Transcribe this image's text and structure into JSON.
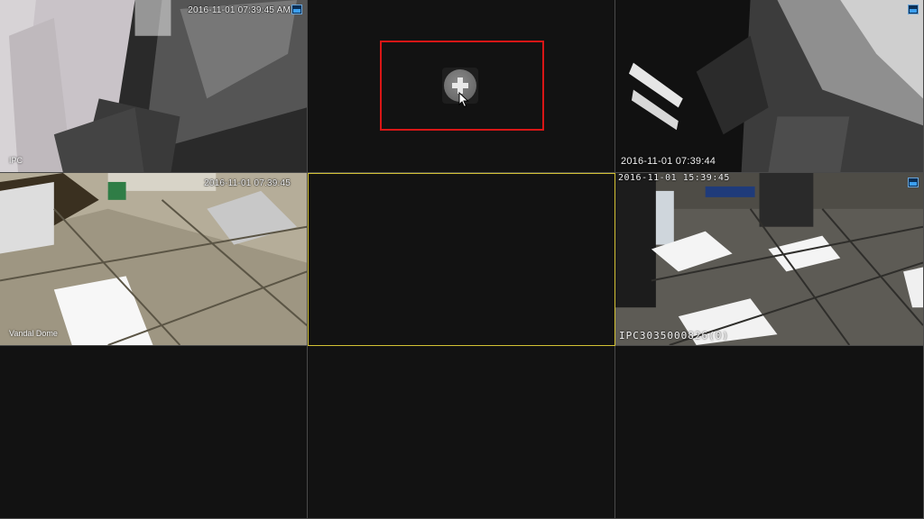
{
  "layout": "3x3",
  "accent_colors": {
    "selected_border": "#d4c234",
    "highlight_box": "#d81616",
    "recording_icon": "#3b9ff0"
  },
  "channels": [
    {
      "id": "ch1",
      "timestamp": "2016-11-01 07:39:45 AM",
      "name": "IPC",
      "has_video": true,
      "recording_icon": "recording-icon"
    },
    {
      "id": "ch2",
      "has_video": false,
      "action": "add-channel",
      "icon": "plus-icon"
    },
    {
      "id": "ch3",
      "timestamp": "2016-11-01 07:39:44",
      "has_video": true,
      "recording_icon": "recording-icon"
    },
    {
      "id": "ch4",
      "timestamp": "2016-11-01 07:39:45",
      "name": "Vandal Dome",
      "has_video": true
    },
    {
      "id": "ch5",
      "has_video": false,
      "selected": true
    },
    {
      "id": "ch6",
      "timestamp": "2016-11-01 15:39:45",
      "name": "IPC3035000826(0)",
      "has_video": true
    },
    {
      "id": "ch7",
      "has_video": false
    },
    {
      "id": "ch8",
      "has_video": false
    },
    {
      "id": "ch9",
      "has_video": false
    }
  ]
}
